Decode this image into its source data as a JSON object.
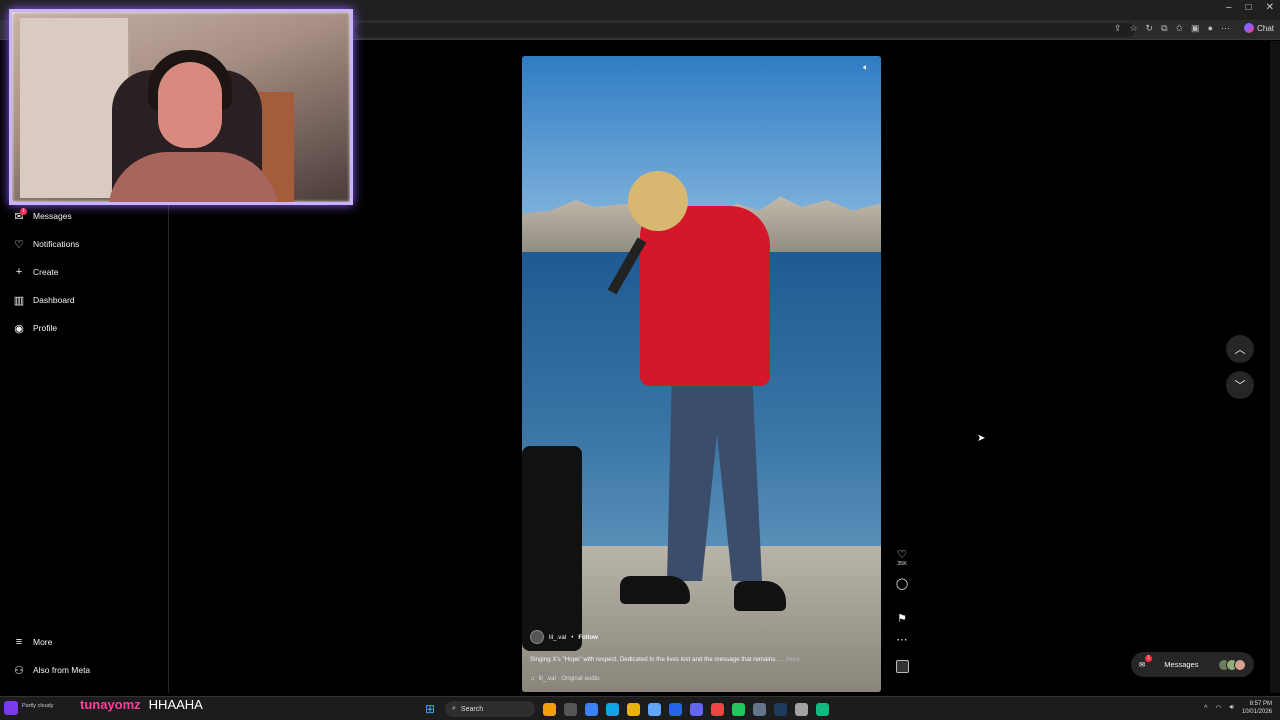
{
  "window": {
    "controls": [
      "–",
      "□",
      "✕"
    ]
  },
  "browser": {
    "toolbar_icons": [
      "share-icon",
      "star-icon",
      "refresh-icon",
      "extensions-icon",
      "favorites-icon",
      "collections-icon",
      "profile-icon",
      "menu-icon"
    ],
    "chat_label": "Chat"
  },
  "sidebar": {
    "items": [
      {
        "label": "Messages",
        "icon": "messenger-icon",
        "badge": "1"
      },
      {
        "label": "Notifications",
        "icon": "heart-icon"
      },
      {
        "label": "Create",
        "icon": "plus-icon"
      },
      {
        "label": "Dashboard",
        "icon": "dashboard-icon"
      },
      {
        "label": "Profile",
        "icon": "avatar"
      }
    ],
    "bottom": [
      {
        "label": "More",
        "icon": "hamburger-icon"
      },
      {
        "label": "Also from Meta",
        "icon": "meta-icon"
      }
    ]
  },
  "reel": {
    "username": "lil_.val",
    "separator": "•",
    "follow_label": "Follow",
    "description": "Singing X's \"Hope\" with respect. Dedicated to the lives lost and the message that remains.",
    "more_label": "... more",
    "audio": "lil_.val · Original audio",
    "likes": "35K"
  },
  "messages_pill": {
    "label": "Messages",
    "badge": "1"
  },
  "stream_chat": {
    "user": "tunayomz",
    "message": "HHAAHA"
  },
  "taskbar": {
    "weather": "Partly cloudy",
    "search_placeholder": "Search",
    "time": "8:57 PM",
    "date": "10/01/2026"
  }
}
